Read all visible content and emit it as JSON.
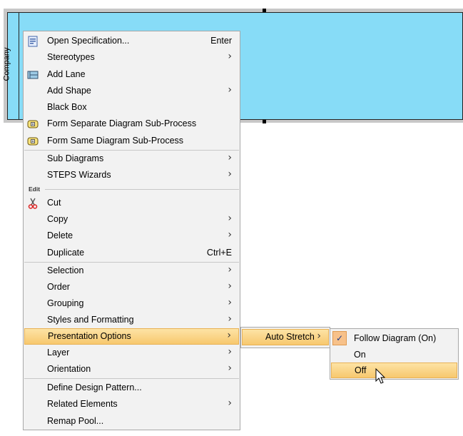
{
  "pool": {
    "label": "Company"
  },
  "context_menu": {
    "items": [
      {
        "label": "Open Specification...",
        "shortcut": "Enter",
        "icon": "specification-icon"
      },
      {
        "label": "Stereotypes",
        "submenu": "›"
      },
      {
        "label": "Add Lane",
        "icon": "lane-icon"
      },
      {
        "label": "Add Shape",
        "submenu": "›"
      },
      {
        "label": "Black Box"
      },
      {
        "label": "Form Separate Diagram Sub-Process",
        "icon": "subprocess-icon"
      },
      {
        "label": "Form Same Diagram Sub-Process",
        "icon": "subprocess-icon"
      },
      {
        "label": "Sub Diagrams",
        "submenu": "›"
      },
      {
        "label": "STEPS Wizards",
        "submenu": "›"
      },
      {
        "label": "Cut",
        "icon": "scissors-icon"
      },
      {
        "label": "Copy",
        "submenu": "›"
      },
      {
        "label": "Delete",
        "submenu": "›"
      },
      {
        "label": "Duplicate",
        "shortcut": "Ctrl+E"
      },
      {
        "label": "Selection",
        "submenu": "›"
      },
      {
        "label": "Order",
        "submenu": "›"
      },
      {
        "label": "Grouping",
        "submenu": "›"
      },
      {
        "label": "Styles and Formatting",
        "submenu": "›"
      },
      {
        "label": "Presentation Options",
        "submenu": "›"
      },
      {
        "label": "Layer",
        "submenu": "›"
      },
      {
        "label": "Orientation",
        "submenu": "›"
      },
      {
        "label": "Define Design Pattern..."
      },
      {
        "label": "Related Elements",
        "submenu": "›"
      },
      {
        "label": "Remap Pool..."
      }
    ],
    "group_edit": "Edit"
  },
  "submenu_presentation": {
    "items": [
      {
        "label": "Auto Stretch",
        "submenu": "›"
      }
    ]
  },
  "submenu_autostretch": {
    "items": [
      {
        "label": "Follow Diagram (On)",
        "checked": "✓"
      },
      {
        "label": "On"
      },
      {
        "label": "Off"
      }
    ]
  },
  "colors": {
    "highlight": "#f7c86e",
    "pool": "#87dcf7",
    "check_bg": "#f4a460"
  }
}
